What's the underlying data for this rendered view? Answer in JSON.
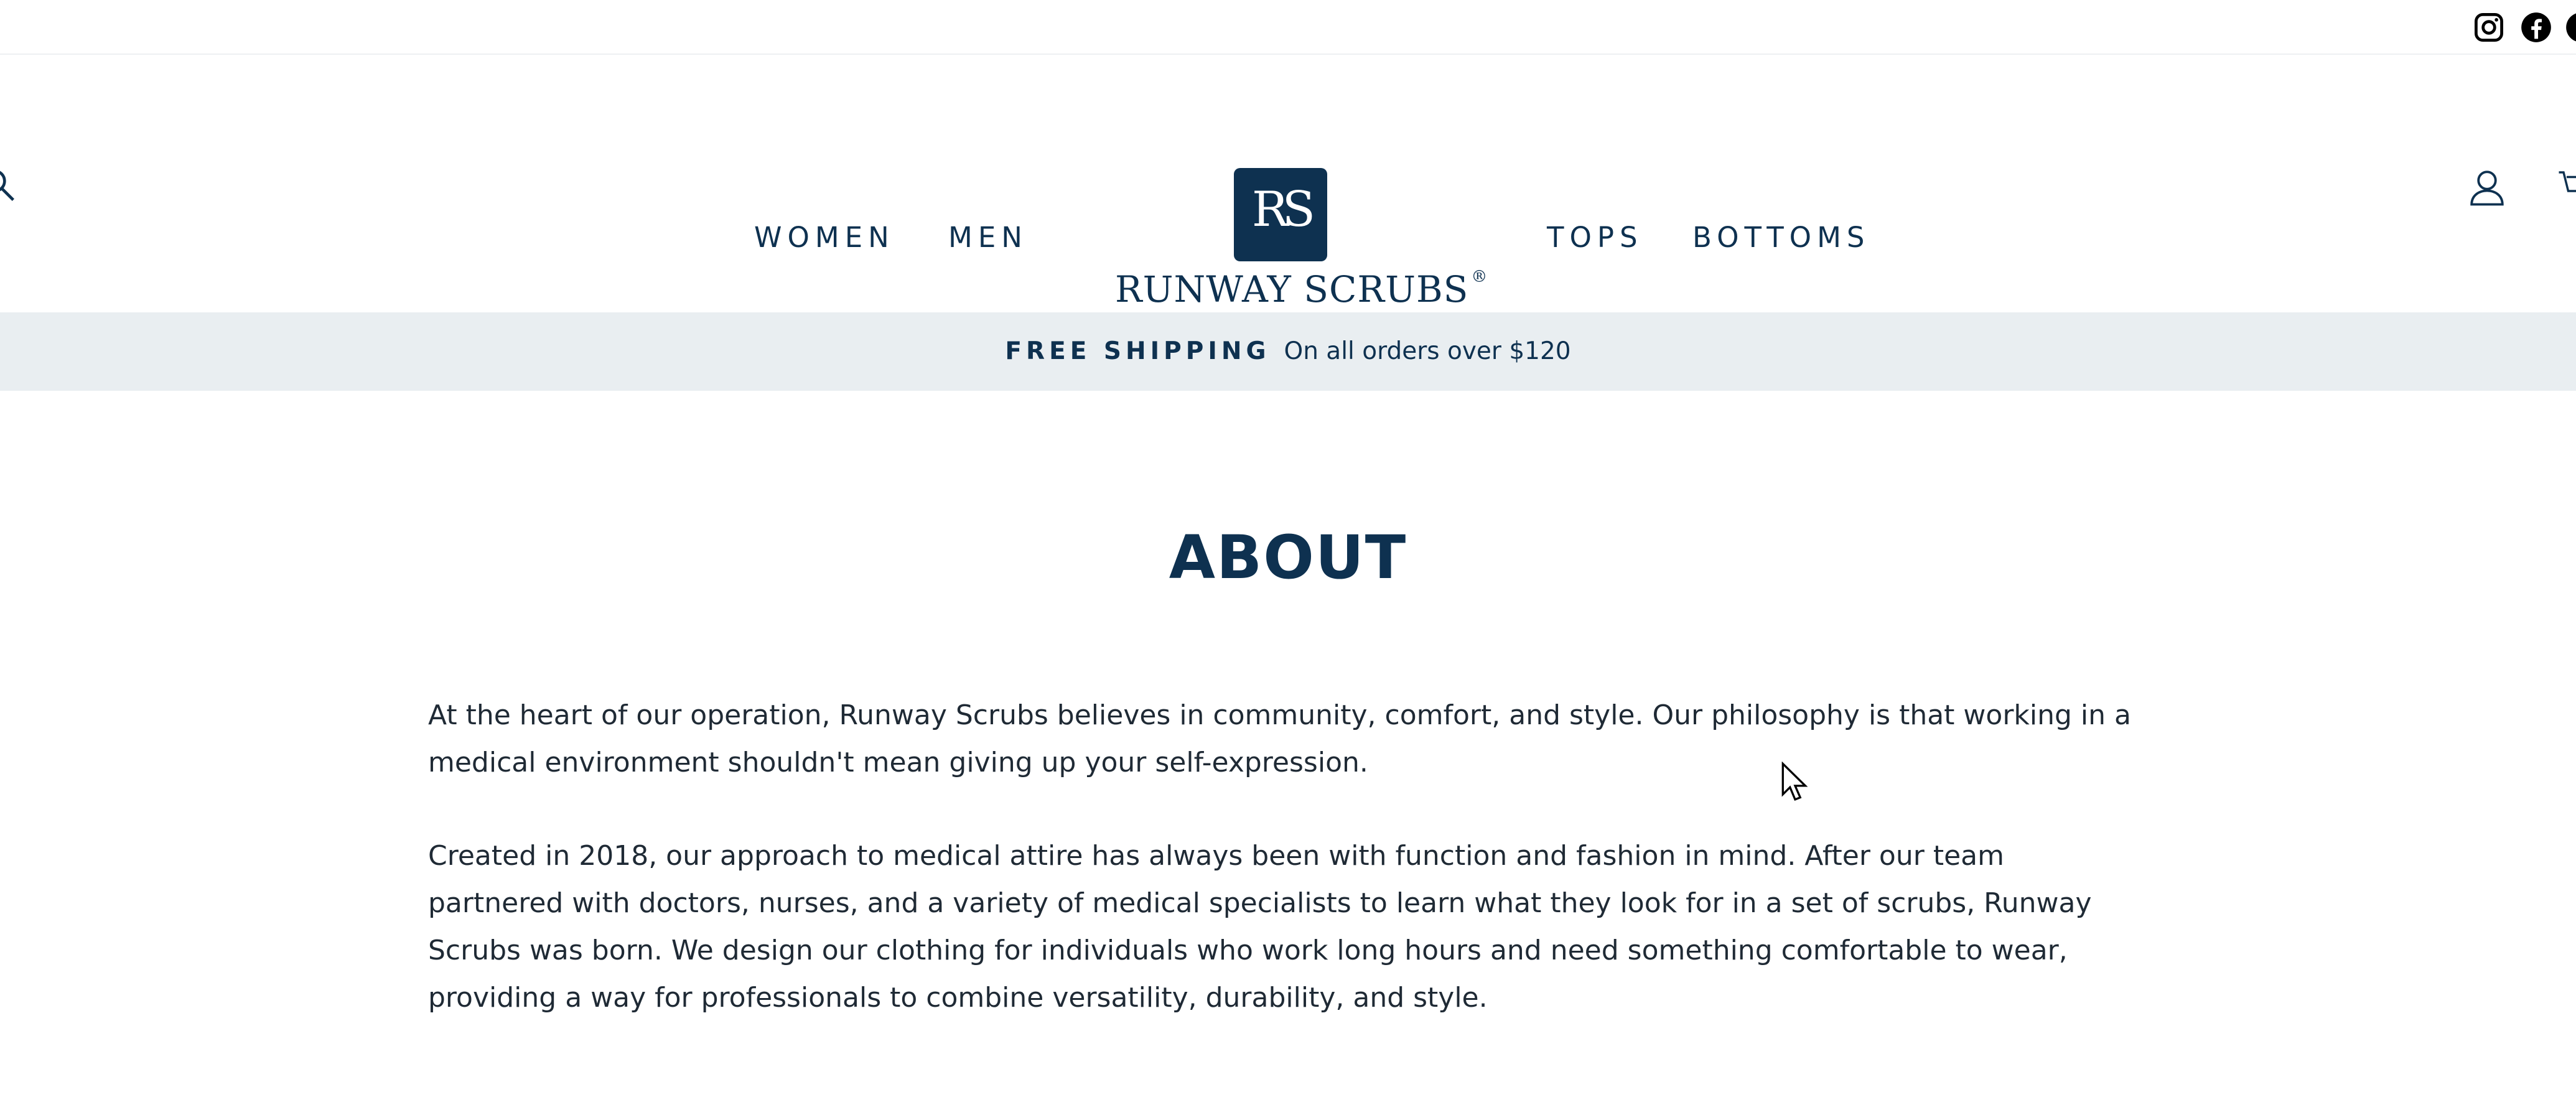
{
  "nav": {
    "left": [
      {
        "label": "WOMEN"
      },
      {
        "label": "MEN"
      }
    ],
    "right": [
      {
        "label": "TOPS"
      },
      {
        "label": "BOTTOMS"
      }
    ]
  },
  "logo": {
    "monogram": "RS",
    "wordmark": "RUNWAY SCRUBS",
    "trademark": "®"
  },
  "header_icons": [
    "search-icon",
    "account-icon",
    "cart-icon"
  ],
  "social_icons": [
    "instagram-icon",
    "facebook-icon",
    "social-icon"
  ],
  "announcement": {
    "label": "FREE SHIPPING",
    "text": "On all orders over $120"
  },
  "page": {
    "title": "ABOUT",
    "paragraphs": [
      "At the heart of our operation, Runway Scrubs believes in community, comfort, and style. Our philosophy is that working in a medical environment shouldn't mean giving up your self-expression.",
      "Created in 2018, our approach to medical attire has always been with function and fashion in mind. After our team partnered with doctors, nurses, and a variety of medical specialists to learn what they look for in a set of scrubs, Runway Scrubs was born. We design our clothing for individuals who work long hours and need something comfortable to wear, providing a way for professionals to combine versatility, durability, and style."
    ]
  },
  "colors": {
    "brand_navy": "#0e3150",
    "announcement_bg": "#e9eef1",
    "body_text": "#1f2a35"
  }
}
